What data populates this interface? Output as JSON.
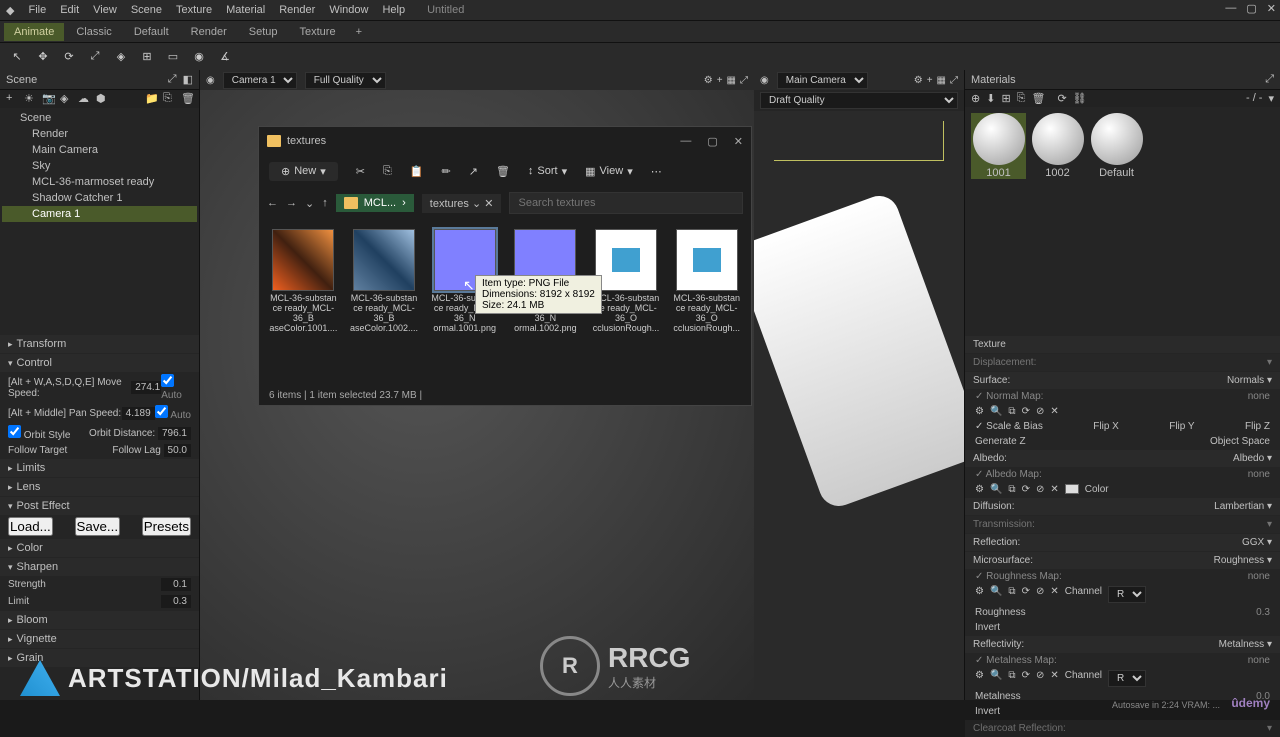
{
  "menu": {
    "items": [
      "File",
      "Edit",
      "View",
      "Scene",
      "Texture",
      "Material",
      "Render",
      "Window",
      "Help"
    ],
    "doc": "Untitled"
  },
  "tabs": {
    "items": [
      "Animate",
      "Classic",
      "Default",
      "Render",
      "Setup",
      "Texture"
    ],
    "active": 0
  },
  "scene": {
    "title": "Scene",
    "items": [
      "Scene",
      "Render",
      "Main Camera",
      "Sky",
      "MCL-36-marmoset ready",
      "Shadow Catcher 1",
      "Camera 1"
    ],
    "selectedIndex": 6
  },
  "transform": {
    "title": "Transform"
  },
  "control": {
    "title": "Control",
    "rows": [
      {
        "l": "[Alt + W,A,S,D,Q,E] Move Speed:",
        "v": "274.1",
        "auto": "Auto"
      },
      {
        "l": "[Alt + Middle]           Pan Speed:",
        "v": "4.189",
        "auto": "Auto"
      }
    ],
    "orbit": {
      "style": "Orbit Style",
      "dist_l": "Orbit Distance:",
      "dist": "796.1"
    },
    "follow": {
      "target": "Follow Target",
      "lag_l": "Follow Lag",
      "lag": "50.0"
    }
  },
  "sections": {
    "limits": "Limits",
    "lens": "Lens",
    "post": "Post Effect",
    "color": "Color",
    "sharpen": "Sharpen",
    "bloom": "Bloom",
    "vignette": "Vignette",
    "grain": "Grain"
  },
  "post": {
    "load": "Load...",
    "save": "Save...",
    "presets": "Presets"
  },
  "sharpen": {
    "strength_l": "Strength",
    "strength": "0.1",
    "limit_l": "Limit",
    "limit": "0.3"
  },
  "viewport1": {
    "camera": "Camera 1",
    "quality": "Full Quality"
  },
  "viewport2": {
    "camera": "Main Camera",
    "quality": "Draft Quality"
  },
  "materials": {
    "title": "Materials",
    "default_preset": "- / -",
    "thumbs": [
      {
        "name": "1001"
      },
      {
        "name": "1002"
      },
      {
        "name": "Default"
      }
    ],
    "selected": 0,
    "sections": {
      "texture": "Texture",
      "displacement": "Displacement:",
      "surface": "Surface:",
      "surface_v": "Normals",
      "albedo": "Albedo:",
      "albedo_v": "Albedo",
      "diffusion": "Diffusion:",
      "diffusion_v": "Lambertian",
      "transmission": "Transmission:",
      "reflection": "Reflection:",
      "reflection_v": "GGX",
      "microsurface": "Microsurface:",
      "microsurface_v": "Roughness",
      "reflectivity": "Reflectivity:",
      "reflectivity_v": "Metalness",
      "clearcoat": "Clearcoat Reflection:"
    },
    "normal": {
      "map_l": "Normal Map:",
      "map_v": "none",
      "scale": "Scale & Bias",
      "flipx": "Flip X",
      "flipy": "Flip Y",
      "flipz": "Flip Z",
      "genz": "Generate Z",
      "space": "Object Space"
    },
    "albedo": {
      "map_l": "Albedo Map:",
      "map_v": "none",
      "color_l": "Color"
    },
    "rough": {
      "map_l": "Roughness Map:",
      "map_v": "none",
      "channel_l": "Channel",
      "channel": "R",
      "rough_l": "Roughness",
      "rough": "0.3",
      "invert": "Invert"
    },
    "metal": {
      "map_l": "Metalness Map:",
      "map_v": "none",
      "channel_l": "Channel",
      "channel": "R",
      "metal_l": "Metalness",
      "metal": "0.0",
      "invert": "Invert"
    }
  },
  "explorer": {
    "title": "textures",
    "new": "New",
    "sort": "Sort",
    "view": "View",
    "crumb1": "MCL...",
    "crumb2": "textures",
    "search_ph": "Search textures",
    "files": [
      {
        "name": "MCL-36-substan\nce\nready_MCL-36_B\naseColor.1001...."
      },
      {
        "name": "MCL-36-substan\nce\nready_MCL-36_B\naseColor.1002...."
      },
      {
        "name": "MCL-36-substan\nce\nready_MCL-36_N\normal.1001.png"
      },
      {
        "name": "MCL-36-substan\nce\nready_MCL-36_N\normal.1002.png"
      },
      {
        "name": "MCL-36-substan\nce\nready_MCL-36_O\ncclusionRough..."
      },
      {
        "name": "MCL-36-substan\nce\nready_MCL-36_O\ncclusionRough..."
      }
    ],
    "status": "6 items   |   1 item selected  23.7 MB   |",
    "tooltip": "Item type: PNG File\nDimensions: 8192 x 8192\nSize: 24.1 MB"
  },
  "watermark": {
    "text": "ARTSTATION/Milad_Kambari",
    "rrcg": "RRCG",
    "rrcg_sub": "人人素材",
    "udemy": "ûdemy"
  },
  "autosave": "Autosave in 2:24   VRAM: ..."
}
